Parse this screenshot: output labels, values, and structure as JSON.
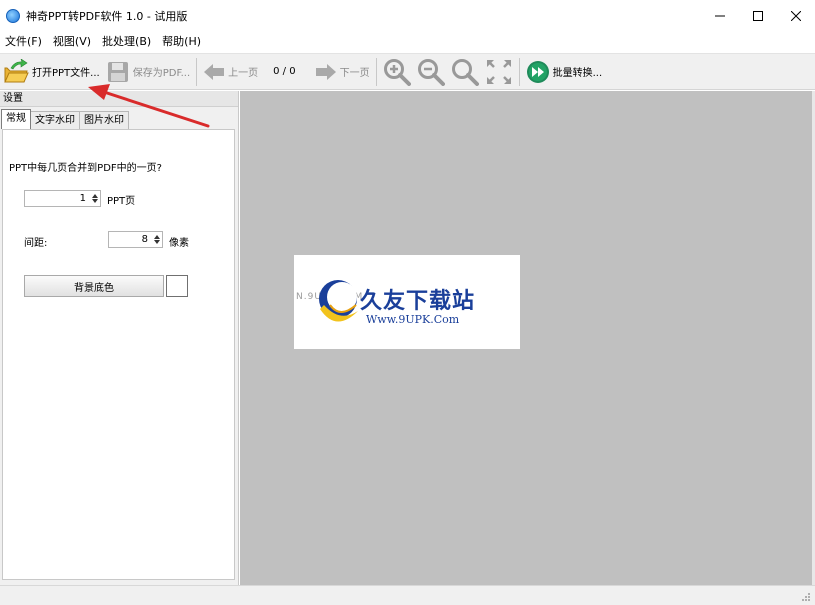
{
  "window": {
    "title": "神奇PPT转PDF软件 1.0 - 试用版",
    "controls": [
      "minimize-icon",
      "maximize-icon",
      "close-icon"
    ]
  },
  "menu": {
    "items": [
      "文件(F)",
      "视图(V)",
      "批处理(B)",
      "帮助(H)"
    ]
  },
  "toolbar": {
    "open_label": "打开PPT文件...",
    "save_label": "保存为PDF...",
    "prev_label": "上一页",
    "page_indicator": "0 / 0",
    "next_label": "下一页",
    "batch_label": "批量转换...",
    "icons": [
      "open-folder-icon",
      "save-floppy-icon",
      "arrow-left-icon",
      "arrow-right-icon",
      "zoom-in-icon",
      "zoom-out-icon",
      "zoom-reset-icon",
      "fit-page-icon",
      "batch-convert-icon"
    ]
  },
  "settings": {
    "header": "设置",
    "tabs": [
      "常规",
      "文字水印",
      "图片水印"
    ],
    "active_tab": 0,
    "question": "PPT中每几页合并到PDF中的一页?",
    "pages_value": "1",
    "pages_unit": "PPT页",
    "spacing_label": "间距:",
    "spacing_value": "8",
    "spacing_unit": "像素",
    "bg_button": "背景底色",
    "bg_color": "#ffffff"
  },
  "preview": {
    "bg_color": "#c0c0c0",
    "watermark": {
      "left_text": "N.9UPK.COM",
      "cn_text": "久友下载站",
      "url_text": "Www.9UPK.Com"
    }
  },
  "colors": {
    "annotation_arrow": "#d92b2b",
    "toolbar_icon_gray": "#9a9a9a",
    "batch_icon": "#1f8a5a"
  }
}
